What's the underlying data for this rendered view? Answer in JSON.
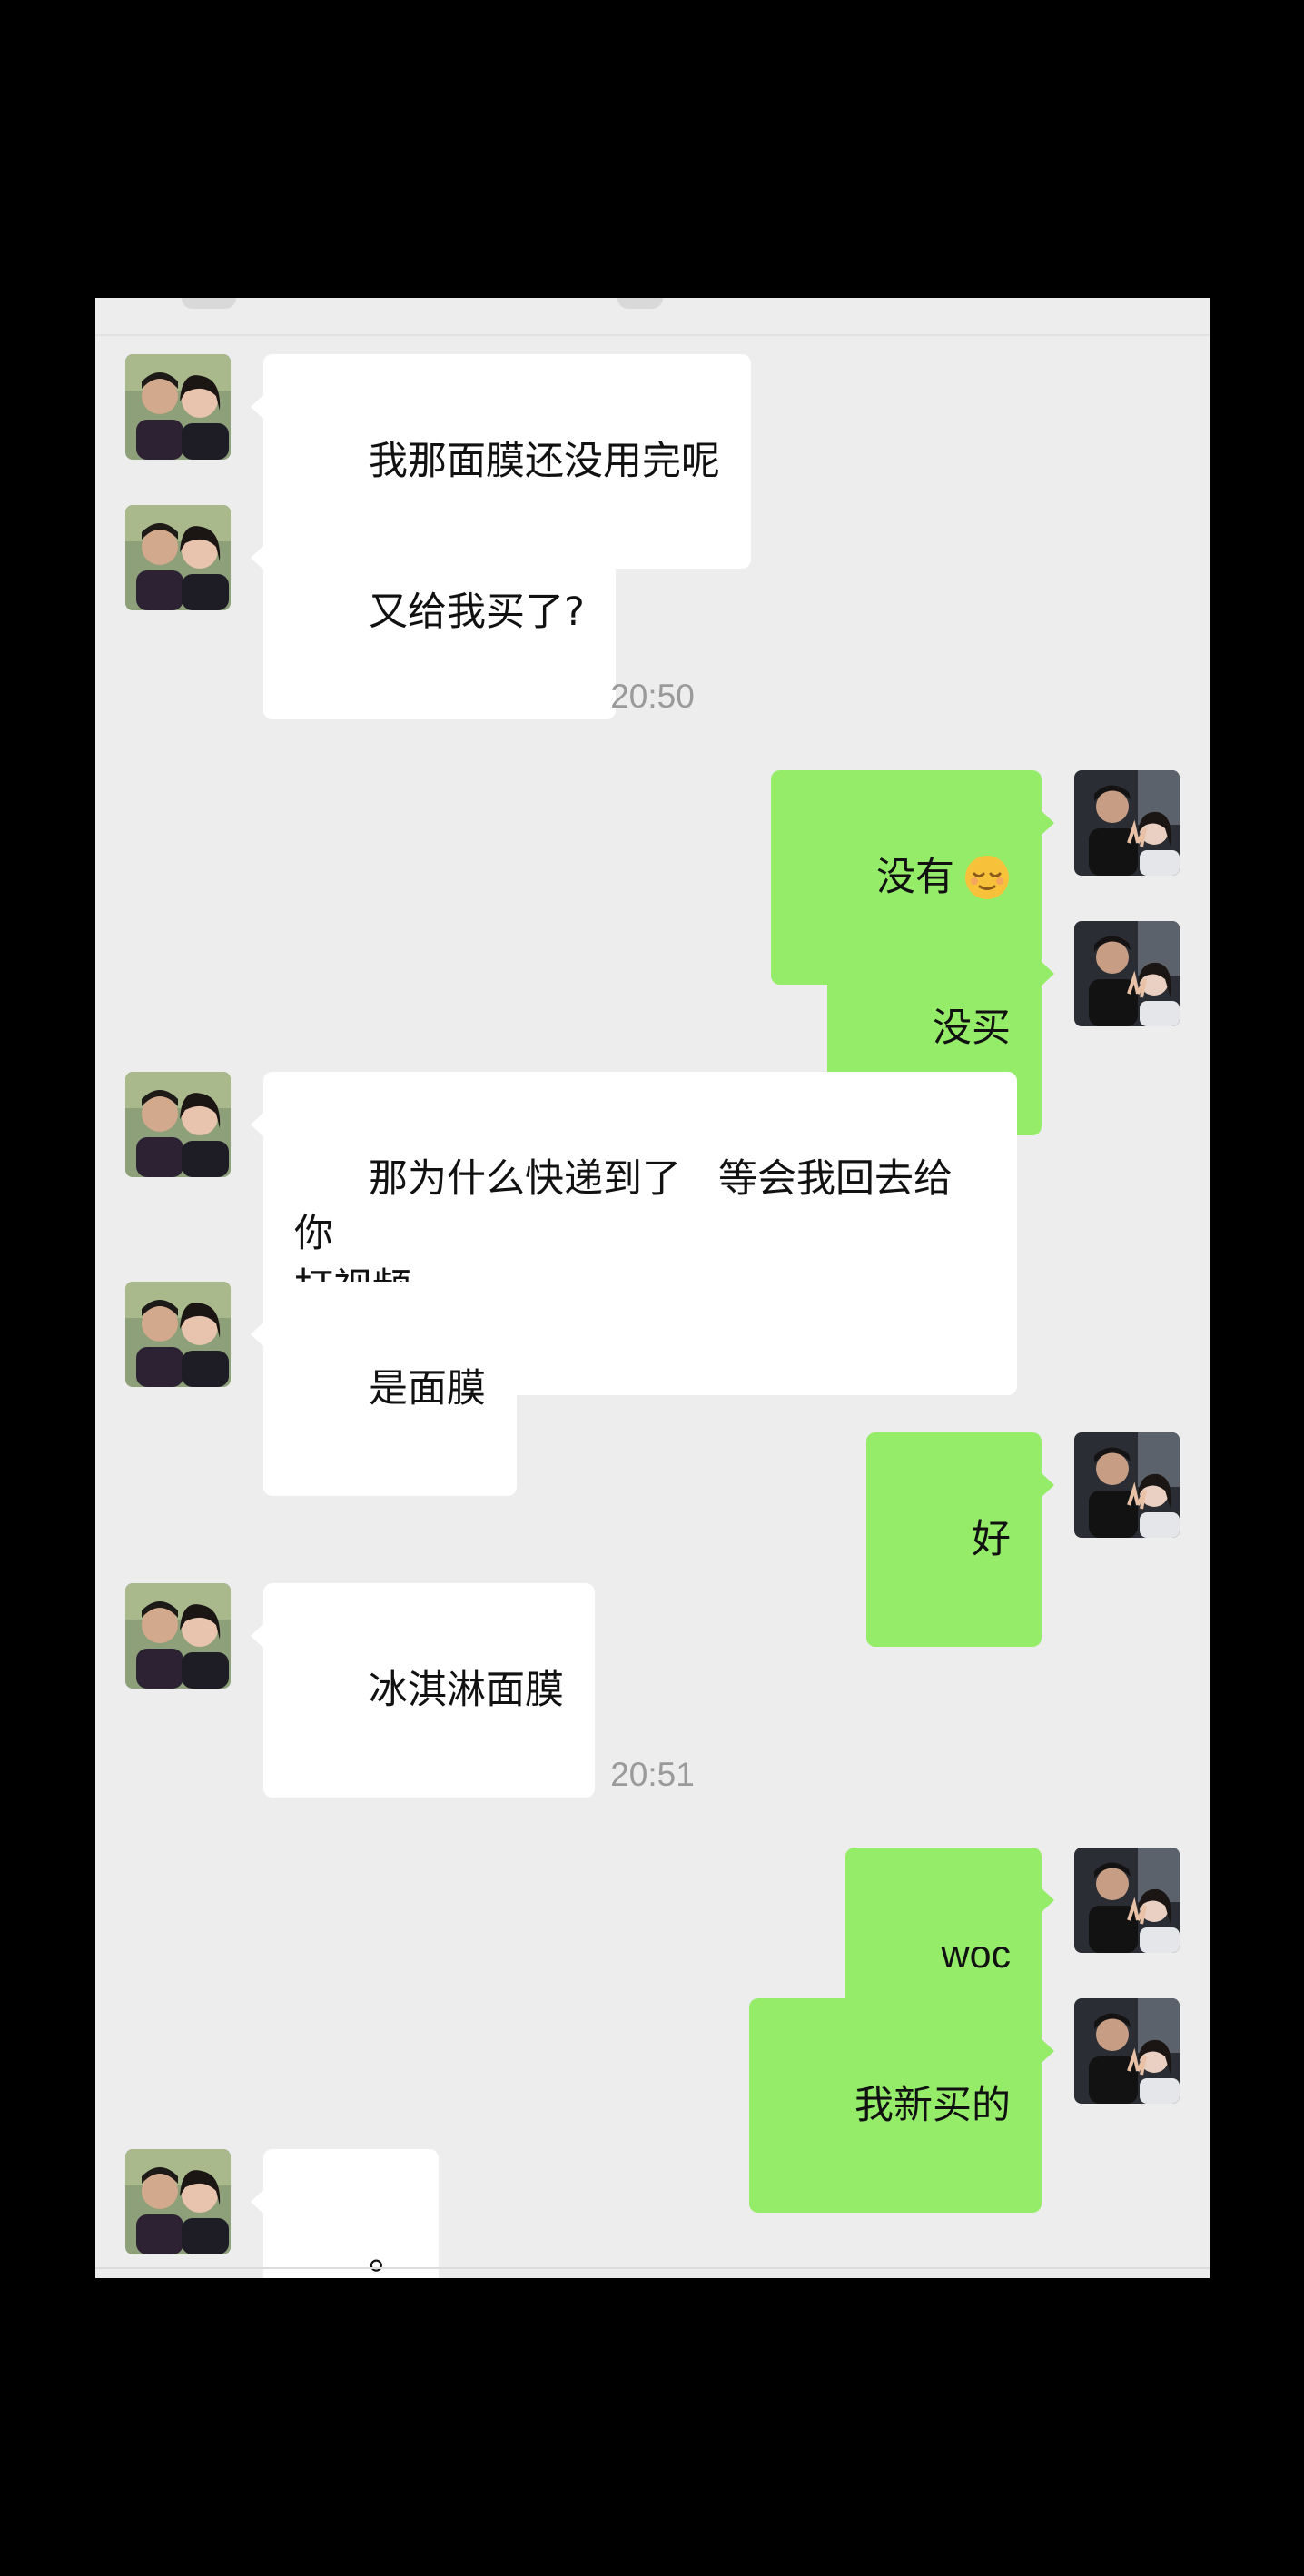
{
  "chat": {
    "timestamps": {
      "t1": "20:50",
      "t2": "20:51"
    },
    "messages": {
      "m1": "我那面膜还没用完呢",
      "m2": "又给我买了?",
      "m3": "没有",
      "m4": "没买",
      "m5": "那为什么快递到了   等会我回去给你\n打视频",
      "m6": "是面膜",
      "m7": "好",
      "m8": "冰淇淋面膜",
      "m9": "woc",
      "m10": "我新买的",
      "m11": "。"
    },
    "emoji_m3": "relieved-face-emoji"
  },
  "colors": {
    "sent_bubble": "#95ec69",
    "received_bubble": "#ffffff",
    "chat_background": "#ededed",
    "timestamp_text": "#9a9a9a"
  }
}
